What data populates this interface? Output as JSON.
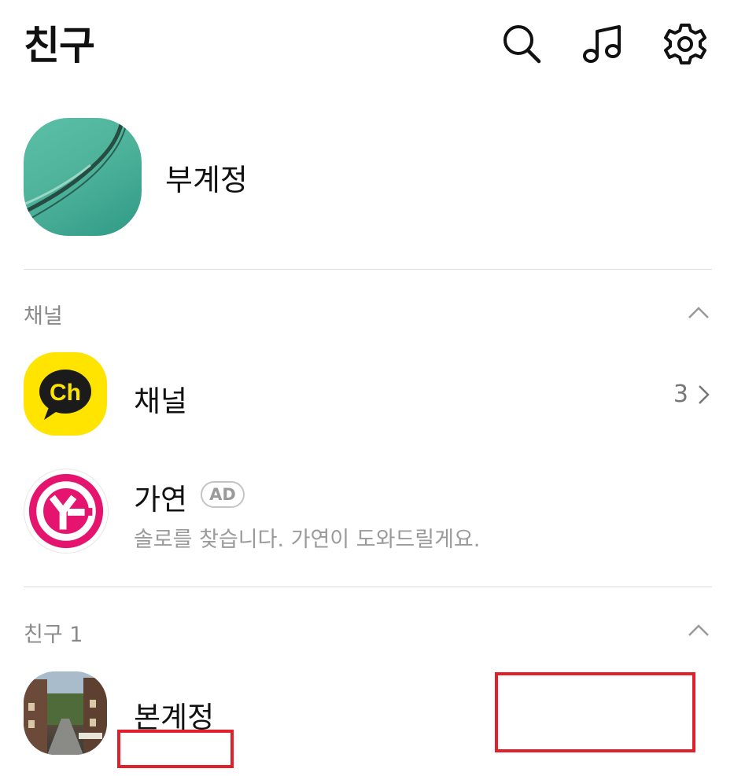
{
  "header": {
    "title": "친구",
    "icons": [
      "search-icon",
      "music-note-icon",
      "gear-icon"
    ]
  },
  "my_profile": {
    "name": "부계정"
  },
  "channel_section": {
    "title": "채널",
    "channel_item": {
      "name": "채널",
      "count": "3"
    },
    "ad_item": {
      "name": "가연",
      "badge": "AD",
      "description": "솔로를 찾습니다. 가연이 도와드릴게요."
    }
  },
  "friends_section": {
    "title": "친구 1",
    "friends": [
      {
        "name": "본계정"
      }
    ]
  },
  "colors": {
    "channel_yellow": "#FFE400",
    "ad_pink": "#E5156F",
    "divider": "#DEDEDE",
    "redaction": "#E0202A"
  }
}
